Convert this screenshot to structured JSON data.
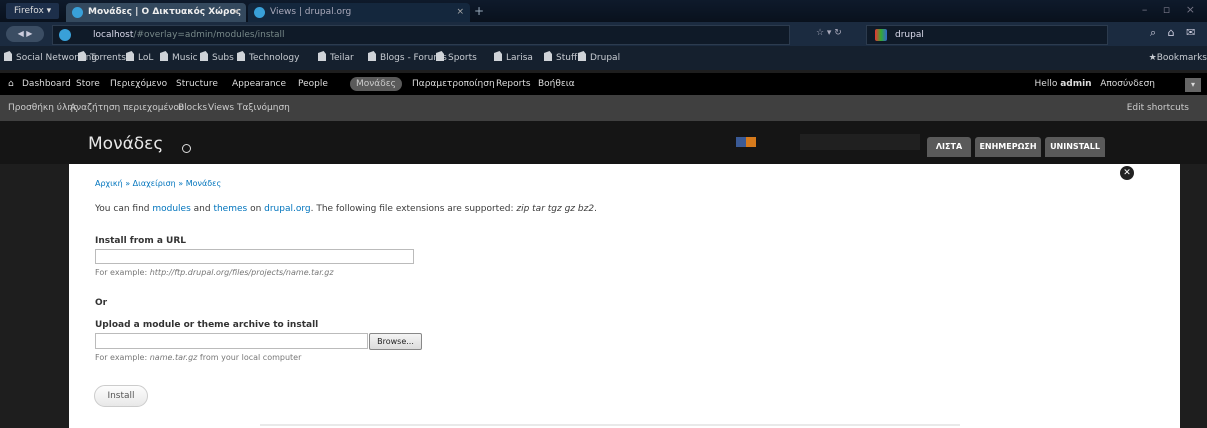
{
  "browser": {
    "firefox_button": "Firefox ▾",
    "tabs": [
      {
        "label": "Μονάδες | Ο Δικτυακός Χώρος το...",
        "close": "×"
      },
      {
        "label": "Views | drupal.org",
        "close": "×"
      }
    ],
    "new_tab": "+",
    "window_controls": "– ▫ ×",
    "url_host": "localhost",
    "url_path": "/#overlay=admin/modules/install",
    "search_text": "drupal",
    "bookmarks": [
      "Social Networking",
      "Torrents",
      "LoL",
      "Music",
      "Subs",
      "Technology",
      "Teilar",
      "Blogs - Forums",
      "Sports",
      "Larisa",
      "Stuff",
      "Drupal"
    ],
    "bookmarks_menu": "★Bookmarks"
  },
  "toolbar": {
    "home_icon": "home-icon",
    "items": [
      "Dashboard",
      "Store",
      "Περιεχόμενο",
      "Structure",
      "Appearance",
      "People",
      "Μονάδες",
      "Παραμετροποίηση",
      "Reports",
      "Βοήθεια"
    ],
    "active_index": 6,
    "hello": "Hello",
    "user": "admin",
    "logout": "Αποσύνδεση"
  },
  "shortcuts": {
    "items": [
      "Προσθήκη ύλης",
      "Αναζήτηση περιεχομένου",
      "Blocks",
      "Views",
      "Ταξινόμηση"
    ],
    "edit": "Edit shortcuts"
  },
  "page": {
    "title": "Μονάδες",
    "header_tabs": [
      "ΛΙΣΤΑ",
      "ΕΝΗΜΕΡΩΣΗ",
      "UNINSTALL"
    ],
    "breadcrumb": [
      "Αρχική",
      "Διαχείριση",
      "Μονάδες"
    ],
    "breadcrumb_sep": "»",
    "intro": {
      "prefix": "You can find ",
      "modules": "modules",
      "and": " and ",
      "themes": "themes",
      "on": " on ",
      "site": "drupal.org",
      "suffix": ". The following file extensions are supported: ",
      "extensions": "zip tar tgz gz bz2",
      "end": "."
    },
    "install_url_label": "Install from a URL",
    "install_url_value": "",
    "example_url_prefix": "For example: ",
    "example_url": "http://ftp.drupal.org/files/projects/name.tar.gz",
    "or_label": "Or",
    "upload_label": "Upload a module or theme archive to install",
    "browse_label": "Browse...",
    "example_file_prefix": "For example: ",
    "example_file": "name.tar.gz",
    "example_file_suffix": " from your local computer",
    "install_button": "Install",
    "close_icon": "close-icon"
  }
}
